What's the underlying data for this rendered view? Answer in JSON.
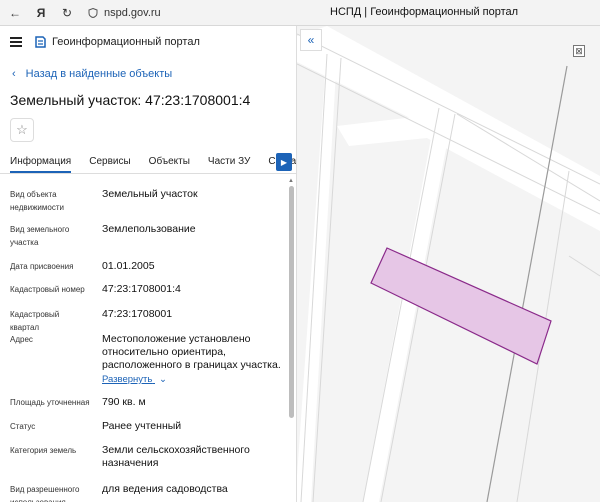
{
  "browser": {
    "url": "nspd.gov.ru",
    "tab_title": "НСПД | Геоинформационный портал"
  },
  "header": {
    "app_title": "Геоинформационный портал"
  },
  "nav": {
    "back_label": "Назад в найденные объекты"
  },
  "object": {
    "title": "Земельный участок: 47:23:1708001:4"
  },
  "tabs": [
    {
      "label": "Информация",
      "active": true
    },
    {
      "label": "Сервисы",
      "active": false
    },
    {
      "label": "Объекты",
      "active": false
    },
    {
      "label": "Части ЗУ",
      "active": false
    },
    {
      "label": "Состав",
      "active": false
    }
  ],
  "properties": [
    {
      "label": "Вид объекта недвижимости",
      "value": "Земельный участок"
    },
    {
      "label": "Вид земельного участка",
      "value": "Землепользование"
    },
    {
      "label": "Дата присвоения",
      "value": "01.01.2005"
    },
    {
      "label": "Кадастровый номер",
      "value": "47:23:1708001:4"
    },
    {
      "label": "Кадастровый квартал",
      "value": "47:23:1708001"
    },
    {
      "label": "Адрес",
      "value": "Местоположение установлено относительно ориентира, расположенного в границах участка."
    },
    {
      "label": "Площадь уточненная",
      "value": "790 кв. м"
    },
    {
      "label": "Статус",
      "value": "Ранее учтенный"
    },
    {
      "label": "Категория земель",
      "value": "Земли сельскохозяйственного назначения"
    },
    {
      "label": "Вид разрешенного использования",
      "value": "для ведения садоводства"
    }
  ],
  "address_expand_label": "Развернуть",
  "icons": {
    "back": "chevron-left-icon",
    "star": "star-icon",
    "collapse": "double-chevron-left-icon"
  },
  "colors": {
    "accent": "#1c63b7",
    "parcel_fill": "#e6c6e6",
    "parcel_stroke": "#8a2a8a"
  }
}
